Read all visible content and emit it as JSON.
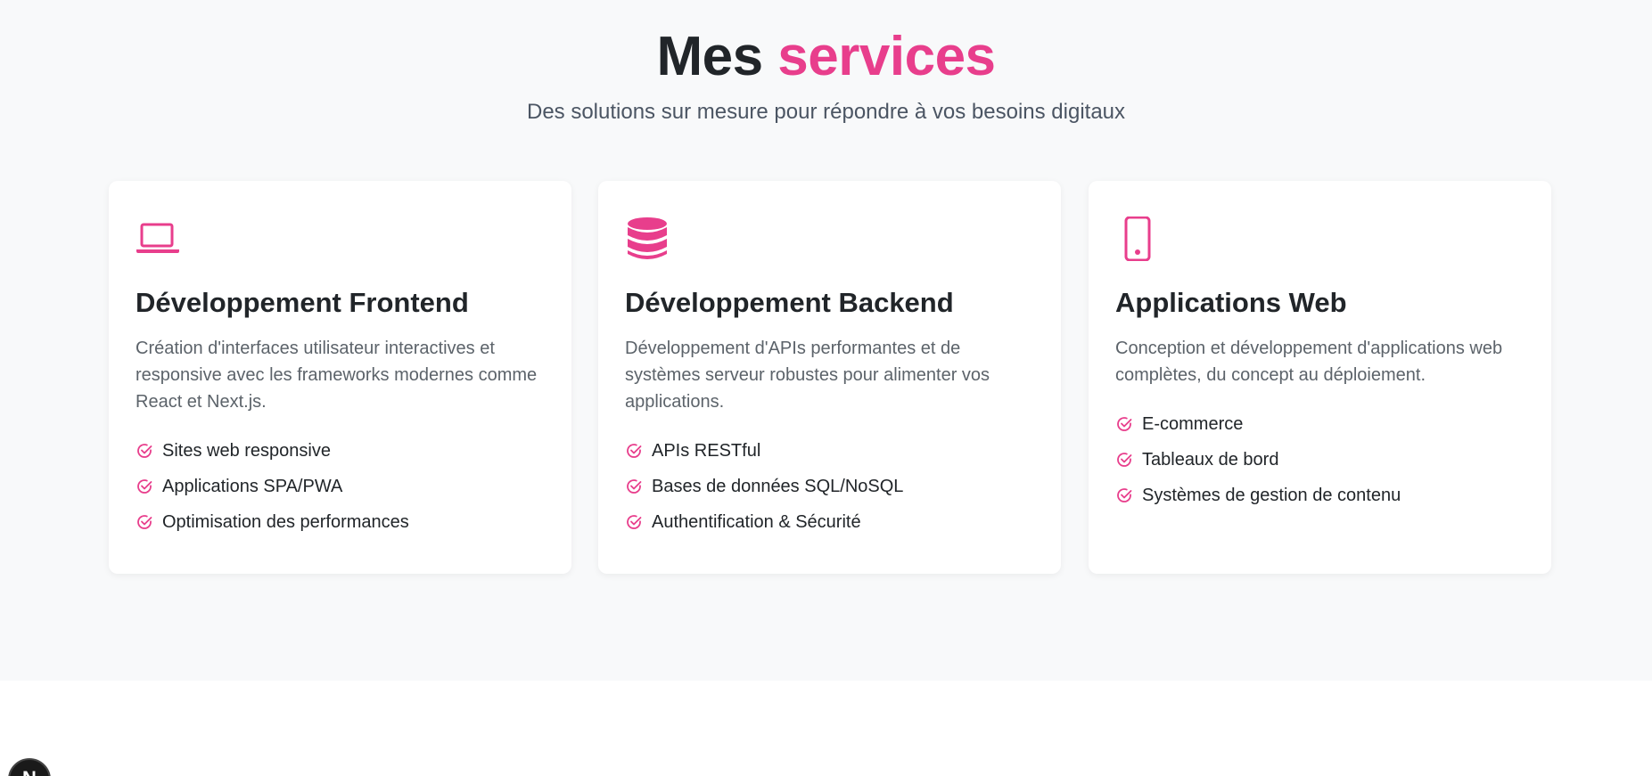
{
  "header": {
    "title_main": "Mes",
    "title_accent": "services",
    "subtitle": "Des solutions sur mesure pour répondre à vos besoins digitaux"
  },
  "colors": {
    "accent": "#e83e8c",
    "background": "#f8f9fa",
    "card": "#ffffff"
  },
  "services": [
    {
      "icon": "laptop-icon",
      "title": "Développement Frontend",
      "description": "Création d'interfaces utilisateur interactives et responsive avec les frameworks modernes comme React et Next.js.",
      "features": [
        "Sites web responsive",
        "Applications SPA/PWA",
        "Optimisation des performances"
      ]
    },
    {
      "icon": "database-icon",
      "title": "Développement Backend",
      "description": "Développement d'APIs performantes et de systèmes serveur robustes pour alimenter vos applications.",
      "features": [
        "APIs RESTful",
        "Bases de données SQL/NoSQL",
        "Authentification & Sécurité"
      ]
    },
    {
      "icon": "mobile-icon",
      "title": "Applications Web",
      "description": "Conception et développement d'applications web complètes, du concept au déploiement.",
      "features": [
        "E-commerce",
        "Tableaux de bord",
        "Systèmes de gestion de contenu"
      ]
    }
  ],
  "badge": {
    "label": "N"
  }
}
